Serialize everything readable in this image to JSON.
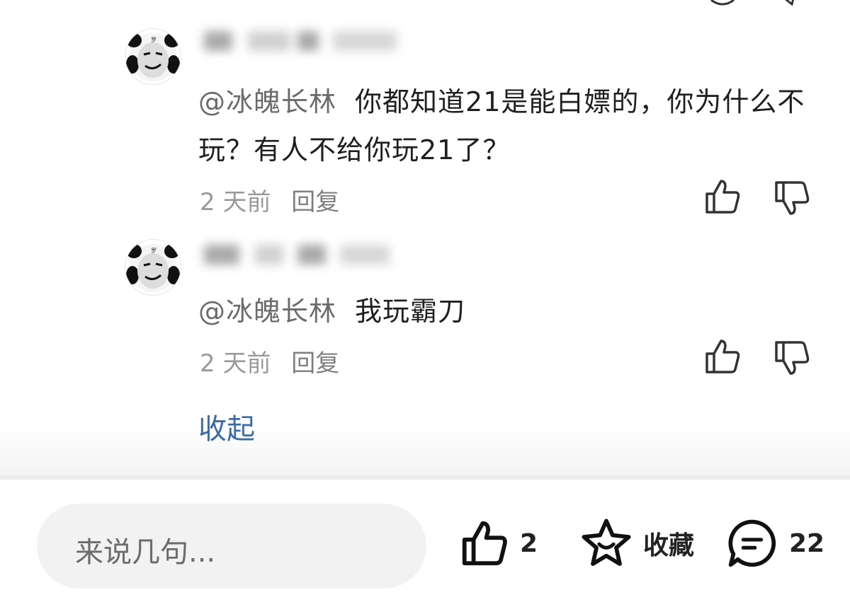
{
  "comments": [
    {
      "mention": "@冰魄长林",
      "text": "你都知道21是能白嫖的，你为什么不玩？有人不给你玩21了？",
      "time": "2 天前",
      "reply_label": "回复"
    },
    {
      "mention": "@冰魄长林",
      "text": "我玩霸刀",
      "time": "2 天前",
      "reply_label": "回复"
    }
  ],
  "collapse_label": "收起",
  "bottom_bar": {
    "input_placeholder": "来说几句...",
    "like_count": "2",
    "favorite_label": "收藏",
    "comment_count": "22"
  },
  "icons": {
    "like": "thumbs-up-icon",
    "dislike": "thumbs-down-icon",
    "favorite": "star-icon",
    "comment": "comment-bubble-icon"
  },
  "colors": {
    "link": "#3c6aa8",
    "muted": "#9a9a9a",
    "input_bg": "#f2f2f2"
  }
}
